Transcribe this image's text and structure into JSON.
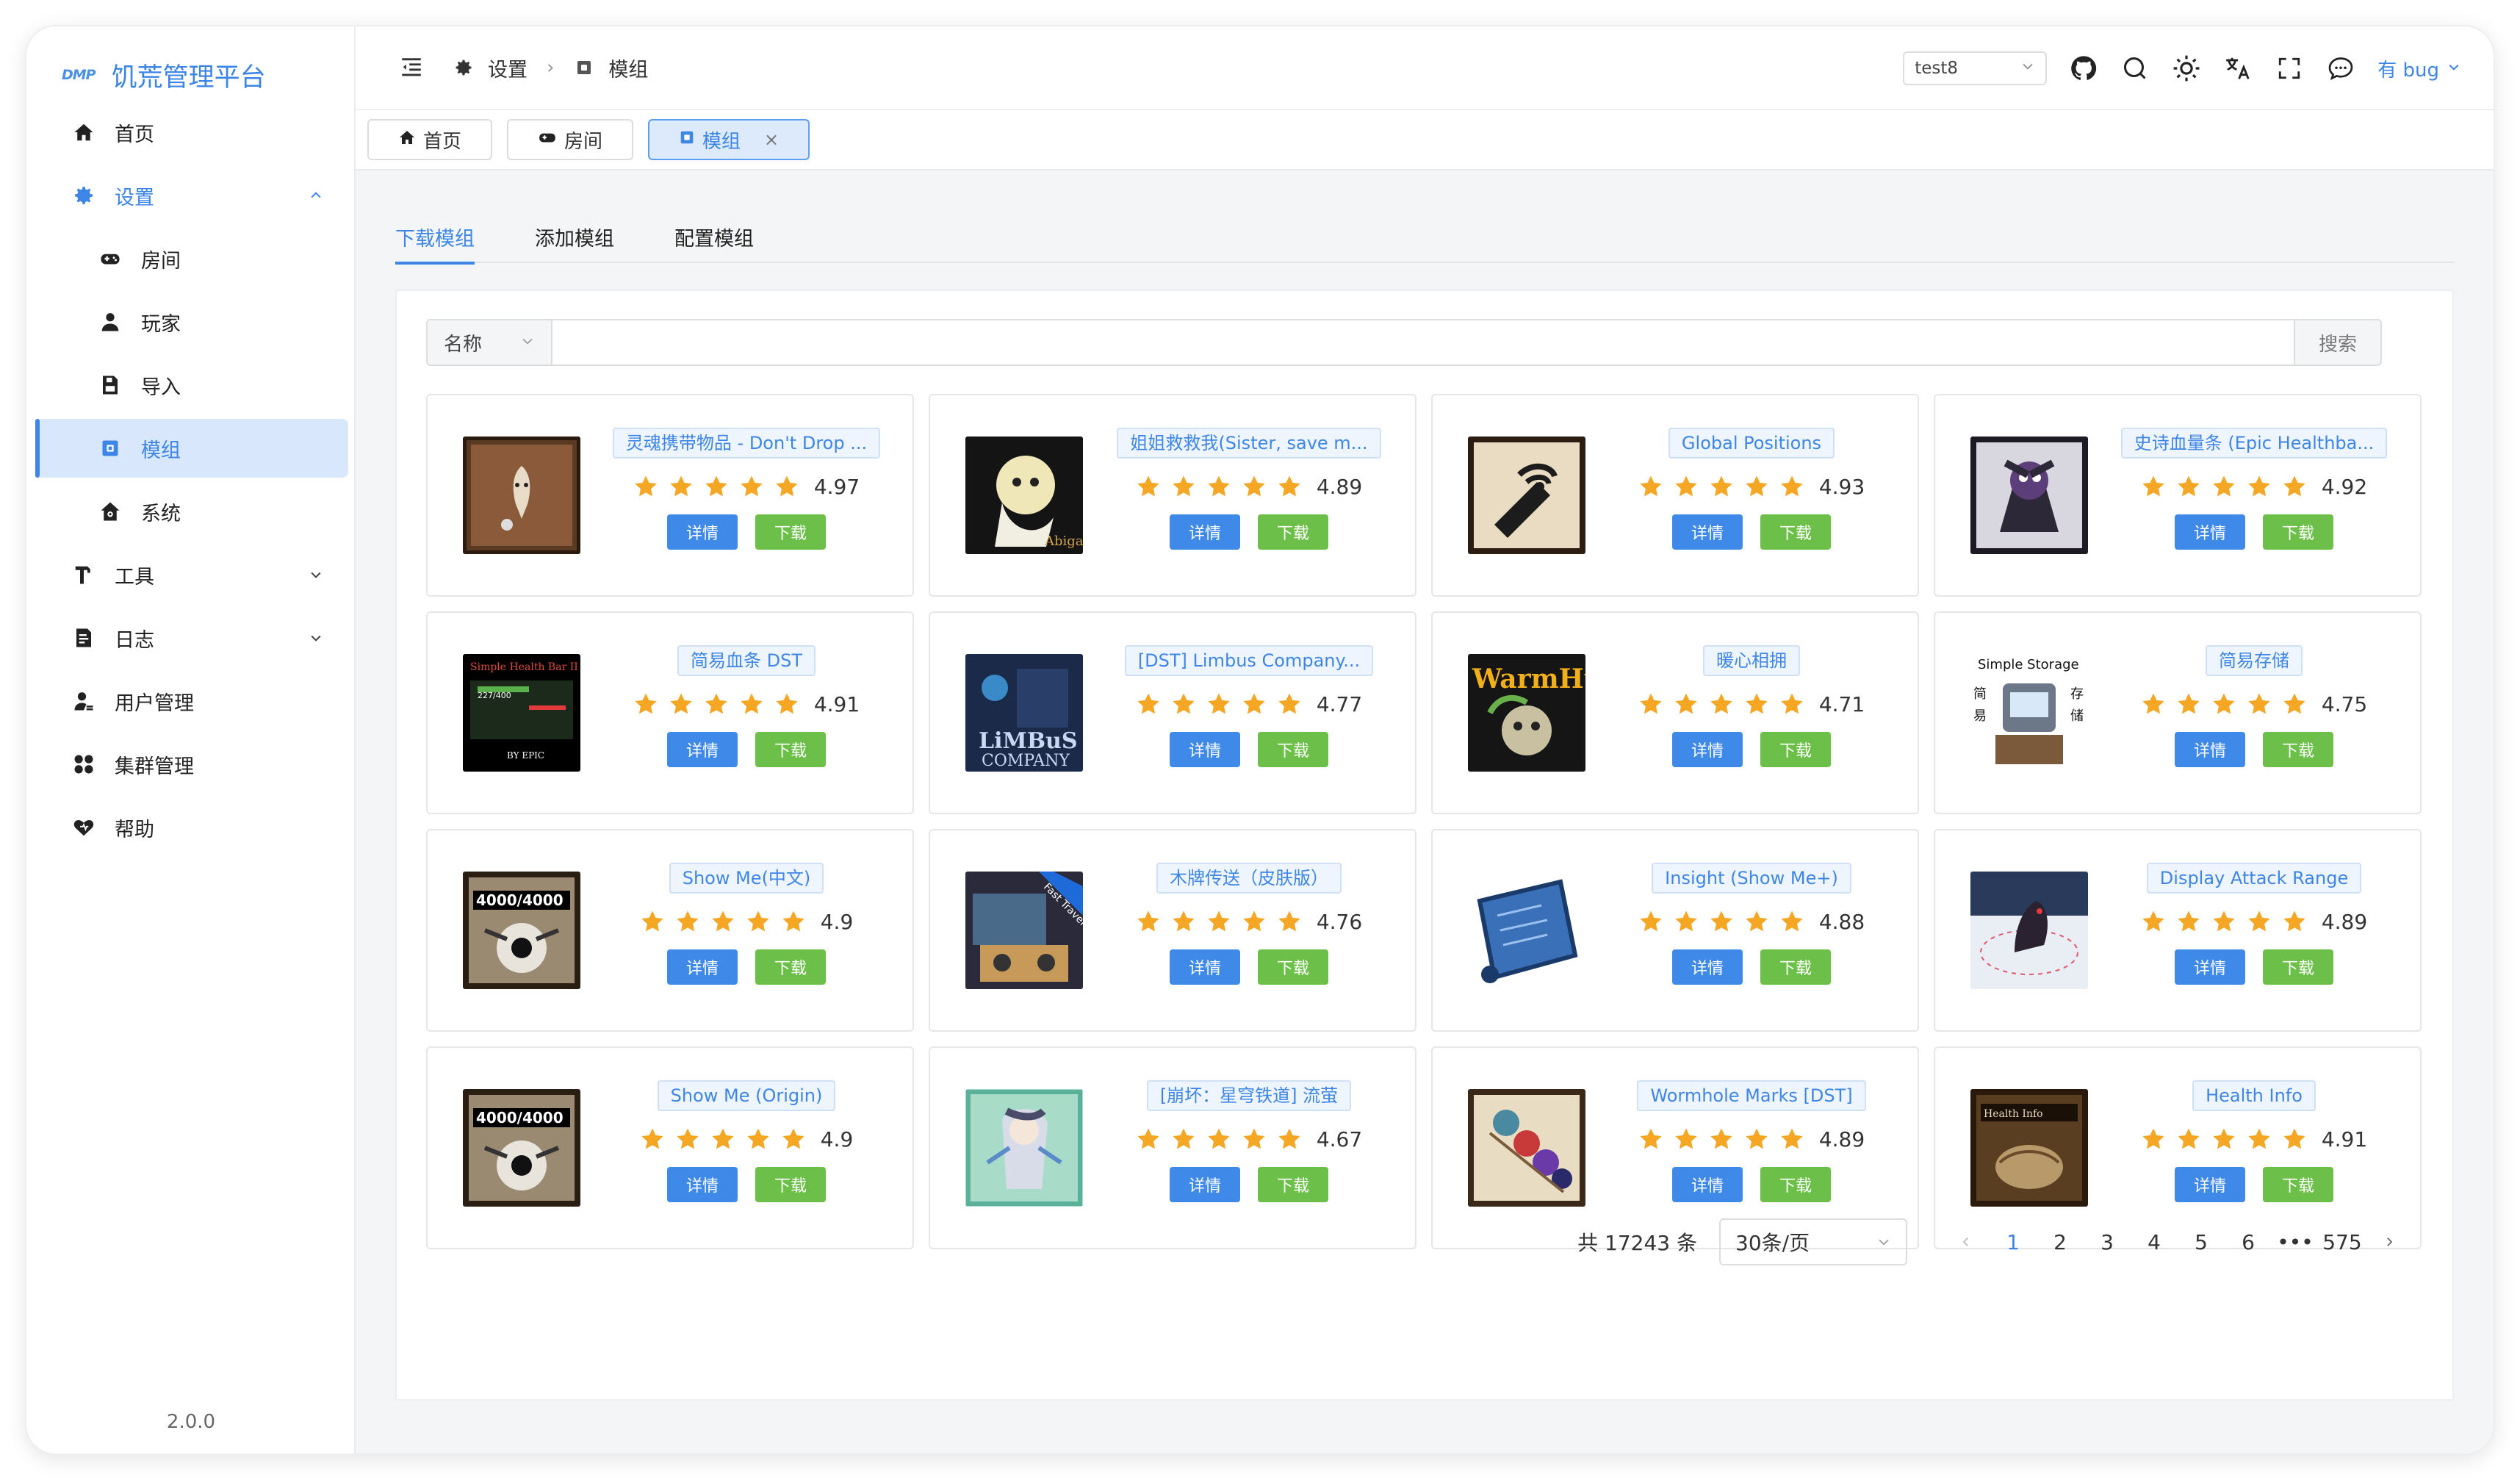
{
  "app": {
    "logo_mark": "DMP",
    "title": "饥荒管理平台",
    "version": "2.0.0"
  },
  "sidebar": {
    "items": [
      {
        "label": "首页",
        "icon": "home-icon"
      },
      {
        "label": "设置",
        "icon": "gear-icon"
      },
      {
        "label": "房间",
        "icon": "gamepad-icon"
      },
      {
        "label": "玩家",
        "icon": "user-icon"
      },
      {
        "label": "导入",
        "icon": "import-icon"
      },
      {
        "label": "模组",
        "icon": "mod-icon"
      },
      {
        "label": "系统",
        "icon": "house-gear-icon"
      },
      {
        "label": "工具",
        "icon": "hammer-icon"
      },
      {
        "label": "日志",
        "icon": "log-icon"
      },
      {
        "label": "用户管理",
        "icon": "user-manage-icon"
      },
      {
        "label": "集群管理",
        "icon": "cluster-icon"
      },
      {
        "label": "帮助",
        "icon": "help-icon"
      }
    ]
  },
  "header": {
    "breadcrumb": [
      "设置",
      "模组"
    ],
    "cluster_select": "test8",
    "user": "有 bug"
  },
  "page_tabs": [
    {
      "label": "首页"
    },
    {
      "label": "房间"
    },
    {
      "label": "模组",
      "close": "×"
    }
  ],
  "sub_tabs": [
    "下载模组",
    "添加模组",
    "配置模组"
  ],
  "search": {
    "field": "名称",
    "placeholder": "",
    "button": "搜索"
  },
  "card_buttons": {
    "detail": "详情",
    "download": "下载"
  },
  "mods": [
    {
      "title": "灵魂携带物品 - Don't Drop ...",
      "rating": "4.97"
    },
    {
      "title": "姐姐救救我(Sister, save m...",
      "rating": "4.89"
    },
    {
      "title": "Global Positions",
      "rating": "4.93"
    },
    {
      "title": "史诗血量条 (Epic Healthba...",
      "rating": "4.92"
    },
    {
      "title": "简易血条 DST",
      "rating": "4.91"
    },
    {
      "title": "[DST] Limbus Company...",
      "rating": "4.77"
    },
    {
      "title": "暖心相拥",
      "rating": "4.71"
    },
    {
      "title": "简易存储",
      "rating": "4.75",
      "thumb_text": "Simple Storage"
    },
    {
      "title": "Show Me(中文)",
      "rating": "4.9",
      "thumb_text": "4000/4000"
    },
    {
      "title": "木牌传送（皮肤版）",
      "rating": "4.76",
      "thumb_text": "Fast Travel"
    },
    {
      "title": "Insight (Show Me+)",
      "rating": "4.88"
    },
    {
      "title": "Display Attack Range",
      "rating": "4.89"
    },
    {
      "title": "Show Me (Origin)",
      "rating": "4.9",
      "thumb_text": "4000/4000"
    },
    {
      "title": "[崩坏：星穹铁道] 流萤",
      "rating": "4.67"
    },
    {
      "title": "Wormhole Marks [DST]",
      "rating": "4.89"
    },
    {
      "title": "Health Info",
      "rating": "4.91"
    }
  ],
  "pagination": {
    "total": "共 17243 条",
    "page_size": "30条/页",
    "pages": [
      "1",
      "2",
      "3",
      "4",
      "5",
      "6",
      "•••",
      "575"
    ],
    "current": "1"
  },
  "colors": {
    "accent": "#3d86e8",
    "download": "#6cc04a",
    "star": "#f5a623"
  }
}
